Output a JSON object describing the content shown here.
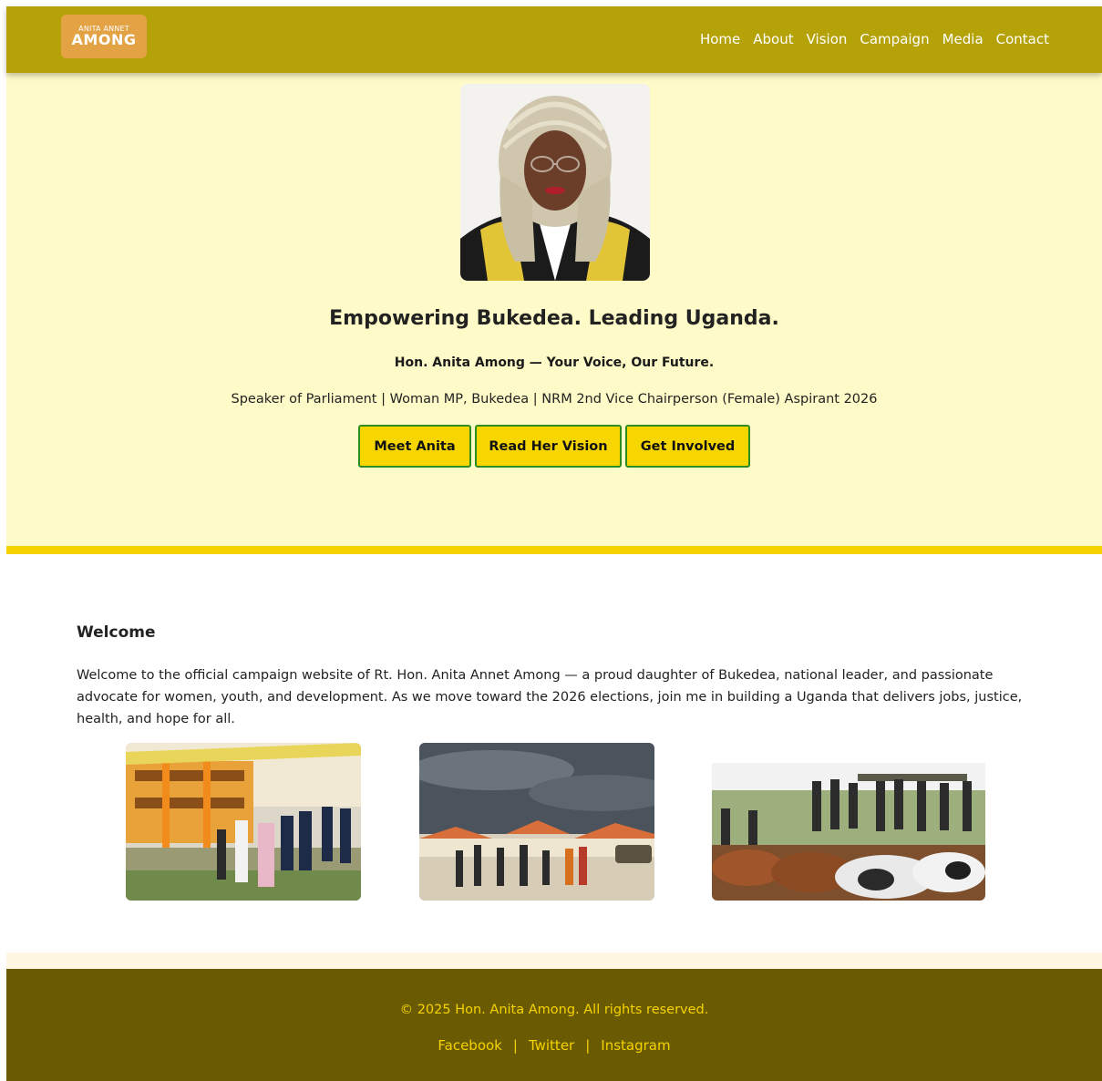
{
  "header": {
    "logo_small": "ANITA ANNET",
    "logo_big": "AMONG",
    "nav": [
      "Home",
      "About",
      "Vision",
      "Campaign",
      "Media",
      "Contact"
    ]
  },
  "hero": {
    "title": "Empowering Bukedea. Leading Uganda.",
    "subtitle": "Hon. Anita Among — Your Voice, Our Future.",
    "description": "Speaker of Parliament | Woman MP, Bukedea | NRM 2nd Vice Chairperson (Female) Aspirant 2026",
    "buttons": [
      "Meet Anita",
      "Read Her Vision",
      "Get Involved"
    ]
  },
  "welcome": {
    "title": "Welcome",
    "text": "Welcome to the official campaign website of Rt. Hon. Anita Annet Among — a proud daughter of Bukedea, national leader, and passionate advocate for women, youth, and development. As we move toward the 2026 elections, join me in building a Uganda that delivers jobs, justice, health, and hope for all."
  },
  "footer": {
    "copyright": "© 2025 Hon. Anita Among. All rights reserved.",
    "links": [
      "Facebook",
      "Twitter",
      "Instagram"
    ],
    "separator": "|"
  },
  "colors": {
    "header_bg": "#b5a208",
    "hero_bg": "#fffbc8",
    "accent_yellow": "#f5d300",
    "button_border": "#2e8b1e",
    "footer_bg": "#6a5b02",
    "logo_bg": "#e3a243"
  }
}
